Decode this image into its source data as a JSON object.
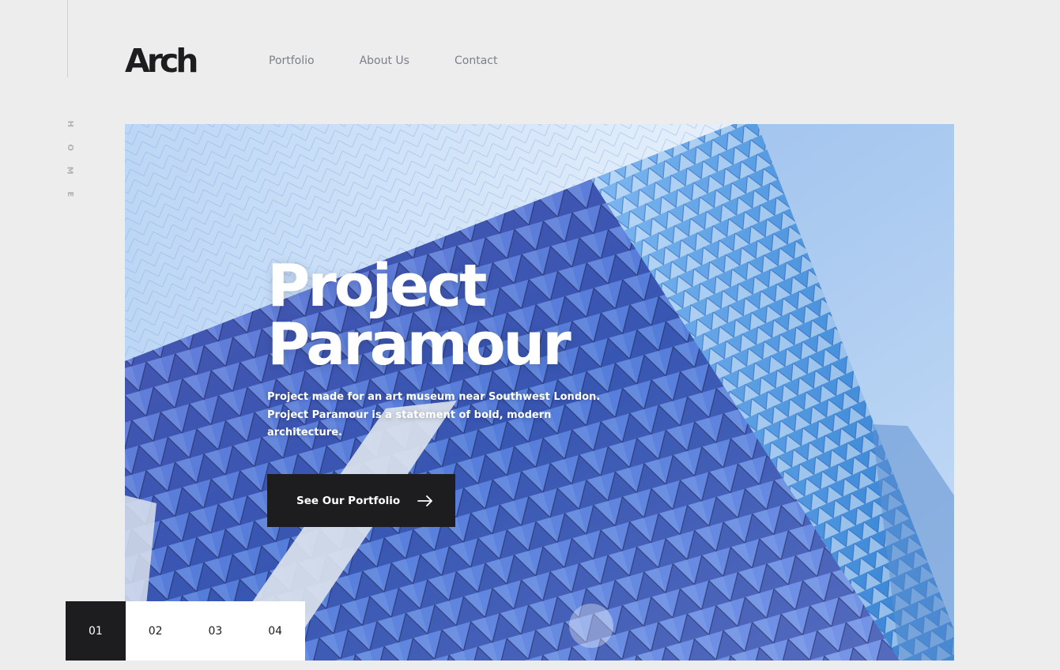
{
  "sidebar": {
    "label_letters": [
      "H",
      "O",
      "M",
      "E"
    ]
  },
  "brand": {
    "logo_text": "Arch"
  },
  "nav": {
    "items": [
      {
        "label": "Portfolio"
      },
      {
        "label": "About Us"
      },
      {
        "label": "Contact"
      }
    ]
  },
  "hero": {
    "title_line1": "Project",
    "title_line2": "Paramour",
    "description": "Project made for an art museum near Southwest London. Project Paramour is a statement of bold, modern architecture.",
    "cta_label": "See Our Portfolio",
    "cta_icon": "arrow-right-icon",
    "background": "photo of glass museum facade with triangular blue panels against sky"
  },
  "slider": {
    "pages": [
      "01",
      "02",
      "03",
      "04"
    ],
    "active_index": 0
  },
  "colors": {
    "page_bg": "#ededed",
    "dark": "#1d1d20",
    "nav_text": "#7b8089",
    "muted": "#b2b2b2",
    "sky": "#a9c8ee",
    "facade_blue": "#3f6fd1"
  }
}
